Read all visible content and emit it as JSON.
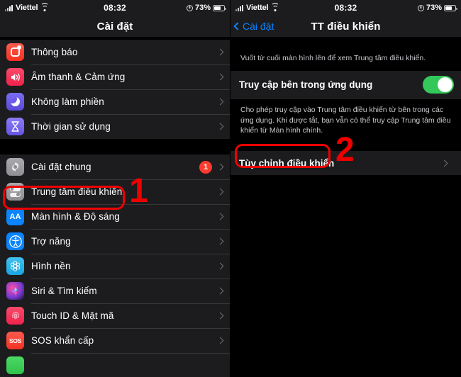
{
  "left": {
    "statusbar": {
      "carrier": "Viettel",
      "time": "08:32",
      "battery": "73%",
      "signal_icon": "cellular-bars-icon",
      "wifi_icon": "wifi-icon",
      "alarm_icon": "alarm-clock-icon",
      "battery_icon": "battery-icon"
    },
    "nav": {
      "title": "Cài đặt"
    },
    "group1": [
      {
        "label": "Thông báo",
        "icon": "notifications-icon"
      },
      {
        "label": "Âm thanh & Cảm ứng",
        "icon": "sound-haptics-icon"
      },
      {
        "label": "Không làm phiền",
        "icon": "do-not-disturb-moon-icon"
      },
      {
        "label": "Thời gian sử dụng",
        "icon": "screen-time-hourglass-icon"
      }
    ],
    "group2": [
      {
        "label": "Cài đặt chung",
        "icon": "general-gear-icon",
        "badge": "1"
      },
      {
        "label": "Trung tâm điều khiển",
        "icon": "control-center-toggles-icon"
      },
      {
        "label": "Màn hình & Độ sáng",
        "icon": "display-brightness-aa-icon"
      },
      {
        "label": "Trợ năng",
        "icon": "accessibility-icon"
      },
      {
        "label": "Hình nền",
        "icon": "wallpaper-icon"
      },
      {
        "label": "Siri & Tìm kiếm",
        "icon": "siri-search-icon"
      },
      {
        "label": "Touch ID & Mật mã",
        "icon": "touch-id-fingerprint-icon"
      },
      {
        "label": "SOS khẩn cấp",
        "icon": "emergency-sos-icon"
      }
    ]
  },
  "right": {
    "statusbar": {
      "carrier": "Viettel",
      "time": "08:32",
      "battery": "73%"
    },
    "nav": {
      "back_label": "Cài đặt",
      "title": "TT điều khiển",
      "back_icon": "chevron-left-icon"
    },
    "hint": "Vuốt từ cuối màn hình lên để xem Trung tâm điều khiển.",
    "access_row": {
      "label": "Truy cập bên trong ứng dụng",
      "toggle_state": "on"
    },
    "footnote": "Cho phép truy cập vào Trung tâm điều khiển từ bên trong các ứng dụng. Khi được tắt, bạn vẫn có thể truy cập Trung tâm điều khiển từ Màn hình chính.",
    "customize_row": {
      "label": "Tùy chỉnh điều khiển"
    }
  },
  "annotations": [
    {
      "number": "1",
      "target": "Trung tâm điều khiển",
      "color": "#ee0000"
    },
    {
      "number": "2",
      "target": "Tùy chỉnh điều khiển",
      "color": "#ee0000"
    }
  ],
  "icons": {
    "sos_text": "SOS",
    "display_text": "AA",
    "hourglass_glyph": "⌛"
  }
}
